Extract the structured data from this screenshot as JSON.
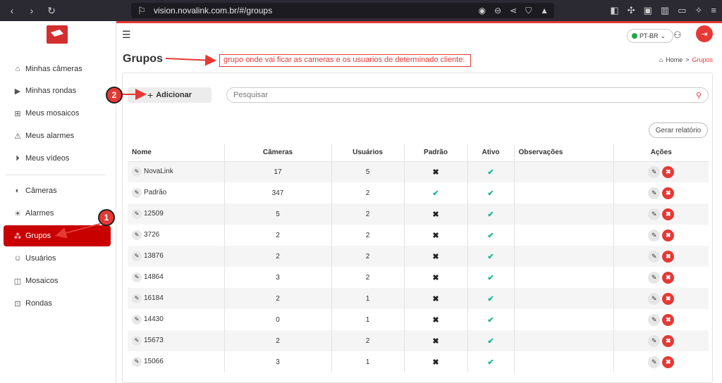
{
  "browser": {
    "url": "vision.novalink.com.br/#/groups"
  },
  "sidebar": {
    "items": [
      {
        "label": "Minhas câmeras"
      },
      {
        "label": "Minhas rondas"
      },
      {
        "label": "Meus mosaicos"
      },
      {
        "label": "Meus alarmes"
      },
      {
        "label": "Meus vídeos"
      },
      {
        "label": "Câmeras"
      },
      {
        "label": "Alarmes"
      },
      {
        "label": "Grupos"
      },
      {
        "label": "Usuários"
      },
      {
        "label": "Mosaicos"
      },
      {
        "label": "Rondas"
      }
    ]
  },
  "topbar": {
    "language": "PT-BR"
  },
  "page": {
    "title": "Grupos",
    "breadcrumb_home": "Home",
    "breadcrumb_current": "Grupos",
    "annotation": "grupo onde vai ficar as cameras e os usuarios de determinado cliente.",
    "marker_1": "1",
    "marker_2": "2"
  },
  "toolbar": {
    "add_label": "Adicionar",
    "search_placeholder": "Pesquisar",
    "report_label": "Gerar relatório"
  },
  "table": {
    "headers": [
      "Nome",
      "Câmeras",
      "Usuários",
      "Padrão",
      "Ativo",
      "Observações",
      "Ações"
    ],
    "rows": [
      {
        "name": "NovaLink",
        "cameras": "17",
        "users": "5",
        "default": false,
        "active": true
      },
      {
        "name": "Padrão",
        "cameras": "347",
        "users": "2",
        "default": true,
        "active": true
      },
      {
        "name": "12509",
        "cameras": "5",
        "users": "2",
        "default": false,
        "active": true
      },
      {
        "name": "3726",
        "cameras": "2",
        "users": "2",
        "default": false,
        "active": true
      },
      {
        "name": "13876",
        "cameras": "2",
        "users": "2",
        "default": false,
        "active": true
      },
      {
        "name": "14864",
        "cameras": "3",
        "users": "2",
        "default": false,
        "active": true
      },
      {
        "name": "16184",
        "cameras": "2",
        "users": "1",
        "default": false,
        "active": true
      },
      {
        "name": "14430",
        "cameras": "0",
        "users": "1",
        "default": false,
        "active": true
      },
      {
        "name": "15673",
        "cameras": "2",
        "users": "2",
        "default": false,
        "active": true
      },
      {
        "name": "15066",
        "cameras": "3",
        "users": "1",
        "default": false,
        "active": true
      }
    ]
  },
  "colors": {
    "accent": "#e53935",
    "active_nav": "#c80000",
    "check": "#1ab394"
  }
}
